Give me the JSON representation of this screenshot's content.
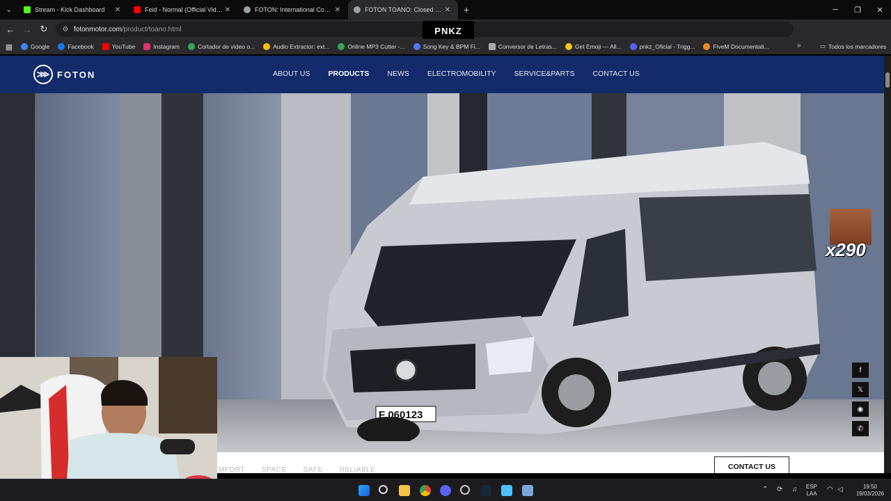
{
  "browser": {
    "tabs": [
      {
        "title": "Stream - Kick Dashboard",
        "color": "#53fc18"
      },
      {
        "title": "Feid - Normal (Official Video) -",
        "color": "#ff0000"
      },
      {
        "title": "FOTON: International Commerc",
        "color": "#9aa0a6"
      },
      {
        "title": "FOTON TOANO: Closed Van Tru",
        "color": "#9aa0a6",
        "active": true
      }
    ],
    "url_host": "fotonmotor.com",
    "url_path": "/product/toano.html",
    "overlay_label": "PNKZ",
    "bookmarks": [
      {
        "label": "Google",
        "color": "#4285f4"
      },
      {
        "label": "Facebook",
        "color": "#1877f2"
      },
      {
        "label": "YouTube",
        "color": "#ff0000"
      },
      {
        "label": "Instagram",
        "color": "#e1306c"
      },
      {
        "label": "Cortador de vídeo o...",
        "color": "#34a853"
      },
      {
        "label": "Audio Extractor: ext...",
        "color": "#fbbc05"
      },
      {
        "label": "Online MP3 Cutter -...",
        "color": "#34a853"
      },
      {
        "label": "Song Key & BPM Fi...",
        "color": "#4f7cff"
      },
      {
        "label": "Conversor de Letras...",
        "color": "#aaaaaa"
      },
      {
        "label": "Get Emoji — All...",
        "color": "#f5c518"
      },
      {
        "label": "pnkz_Oficial - Trigg...",
        "color": "#5865f2"
      },
      {
        "label": "FiveM Documentati...",
        "color": "#f08a24"
      }
    ],
    "all_bookmarks": "Todos los marcadores"
  },
  "site": {
    "brand": "FOTON",
    "nav": [
      {
        "label": "ABOUT US"
      },
      {
        "label": "PRODUCTS",
        "active": true
      },
      {
        "label": "NEWS"
      },
      {
        "label": "ELECTROMOBILITY"
      },
      {
        "label": "SERVICE&PARTS"
      },
      {
        "label": "CONTACT US"
      }
    ],
    "plate": "F 060123",
    "features": [
      "MFORT",
      "SPACE",
      "SAFE",
      "RELIABLE"
    ],
    "contact_button": "CONTACT US",
    "social": [
      "f",
      "𝕏",
      "◉",
      "✆"
    ]
  },
  "stream_overlay": {
    "count": "x290"
  },
  "taskbar": {
    "language": "ESP",
    "layout": "LAA",
    "time": "19:50",
    "date": "19/03/2026"
  }
}
